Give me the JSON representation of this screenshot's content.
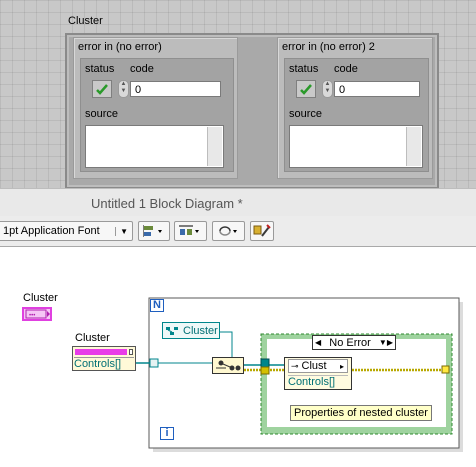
{
  "front_panel": {
    "cluster_label": "Cluster",
    "error_clusters": [
      {
        "title": "error in (no error)",
        "status_label": "status",
        "code_label": "code",
        "code_value": "0",
        "source_label": "source"
      },
      {
        "title": "error in (no error) 2",
        "status_label": "status",
        "code_label": "code",
        "code_value": "0",
        "source_label": "source"
      }
    ]
  },
  "block_diagram": {
    "window_title": "Untitled 1 Block Diagram *",
    "toolbar": {
      "font_selector": "1pt Application Font"
    },
    "terminals": {
      "cluster_control_label": "Cluster",
      "property_node_label": "Cluster",
      "property_node_property": "Controls[]"
    },
    "for_loop": {
      "count_terminal": "N",
      "iteration_terminal": "i"
    },
    "reference_constant": "Cluster",
    "case_structure": {
      "selector": "No Error",
      "inner_node_label": "Clust",
      "inner_node_property": "Controls[]"
    },
    "comment": "Properties of nested cluster"
  },
  "colors": {
    "panel_bg": "#c8c8c8",
    "cluster_pink": "#e83ce8",
    "ref_teal": "#007f86",
    "loop_blue": "#1f5fbf",
    "case_green": "#3aa53a",
    "error_yellow": "#c8b000"
  }
}
